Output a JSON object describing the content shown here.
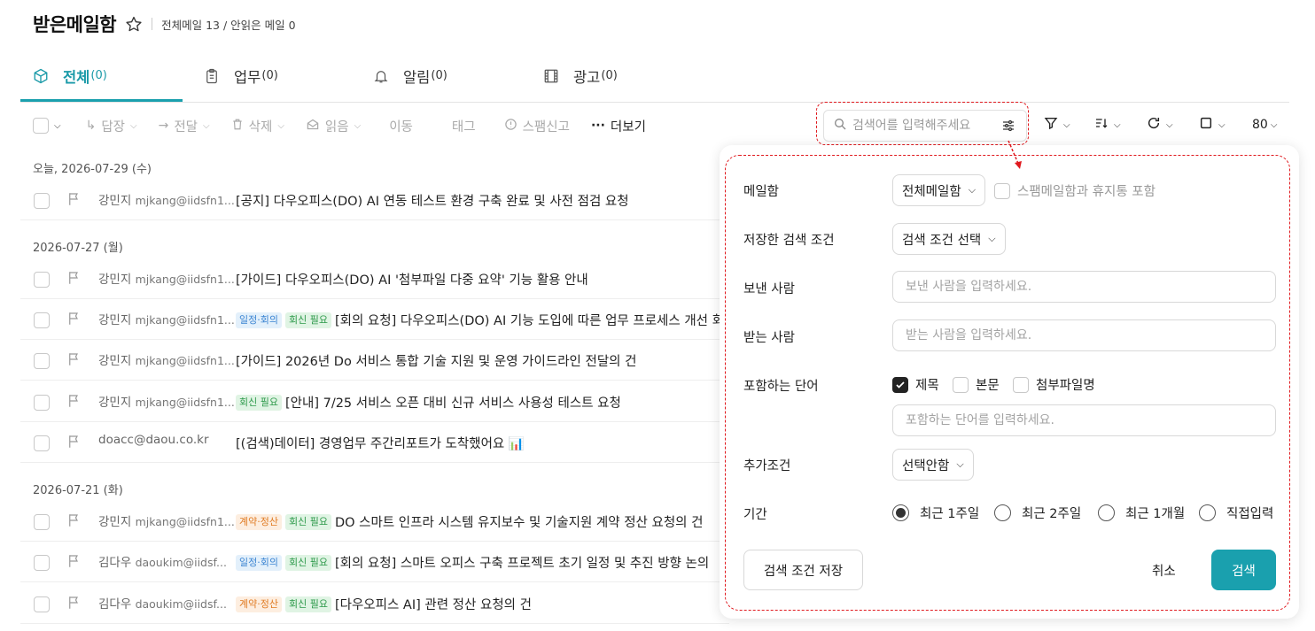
{
  "header": {
    "title": "받은메일함",
    "counts": "전체메일 13 / 안읽은 메일 0"
  },
  "tabs": [
    {
      "label": "전체",
      "count": "(0)",
      "icon": "package-icon"
    },
    {
      "label": "업무",
      "count": "(0)",
      "icon": "clipboard-icon"
    },
    {
      "label": "알림",
      "count": "(0)",
      "icon": "bell-icon"
    },
    {
      "label": "광고",
      "count": "(0)",
      "icon": "film-icon"
    }
  ],
  "toolbar": {
    "reply": "답장",
    "forward": "전달",
    "delete": "삭제",
    "read": "읽음",
    "move": "이동",
    "tag": "태그",
    "spam": "스팸신고",
    "more": "더보기",
    "page_size": "80"
  },
  "search": {
    "placeholder": "검색어를 입력해주세요"
  },
  "groups": [
    {
      "date": "오늘, 2026-07-29 (수)"
    },
    {
      "date": "2026-07-27 (월)"
    },
    {
      "date": "2026-07-21 (화)"
    }
  ],
  "mails": [
    {
      "sender": "강민지",
      "email": "mjkang@iidsfn1...",
      "subject": "[공지] 다우오피스(DO) AI 연동 테스트 환경 구축 완료 및 사전 점검 요청",
      "tags": []
    },
    {
      "sender": "강민지",
      "email": "mjkang@iidsfn1...",
      "subject": "[가이드] 다우오피스(DO) AI '첨부파일 다중 요약' 기능 활용 안내",
      "tags": []
    },
    {
      "sender": "강민지",
      "email": "mjkang@iidsfn1...",
      "subject": "[회의 요청] 다우오피스(DO) AI 기능 도입에 따른 업무 프로세스 개선 회의",
      "tags": [
        "일정·회의",
        "회신 필요"
      ]
    },
    {
      "sender": "강민지",
      "email": "mjkang@iidsfn1...",
      "subject": "[가이드] 2026년 Do 서비스 통합 기술 지원 및 운영 가이드라인 전달의 건",
      "tags": []
    },
    {
      "sender": "강민지",
      "email": "mjkang@iidsfn1...",
      "subject": "[안내] 7/25 서비스 오픈 대비 신규 서비스 사용성 테스트 요청",
      "tags": [
        "회신 필요"
      ]
    },
    {
      "sender": "doacc@daou.co.kr",
      "email": "",
      "subject": "[(검색)데이터] 경영업무 주간리포트가 도착했어요 📊",
      "tags": []
    },
    {
      "sender": "강민지",
      "email": "mjkang@iidsfn1...",
      "subject": "DO 스마트 인프라 시스템 유지보수 및 기술지원 계약 정산 요청의 건",
      "tags": [
        "계약·정산",
        "회신 필요"
      ]
    },
    {
      "sender": "김다우",
      "email": "daoukim@iidsf...",
      "subject": "[회의 요청] 스마트 오피스 구축 프로젝트 초기 일정 및 추진 방향 논의",
      "tags": [
        "일정·회의",
        "회신 필요"
      ]
    },
    {
      "sender": "김다우",
      "email": "daoukim@iidsf...",
      "subject": "[다우오피스 AI] 관련 정산 요청의 건",
      "tags": [
        "계약·정산",
        "회신 필요"
      ]
    }
  ],
  "panel": {
    "mailbox_label": "메일함",
    "mailbox_value": "전체메일함",
    "include_spam": "스팸메일함과 휴지통 포함",
    "saved_label": "저장한 검색 조건",
    "saved_value": "검색 조건 선택",
    "from_label": "보낸 사람",
    "from_placeholder": "보낸 사람을 입력하세요.",
    "to_label": "받는 사람",
    "to_placeholder": "받는 사람을 입력하세요.",
    "words_label": "포함하는 단어",
    "opt_subject": "제목",
    "opt_body": "본문",
    "opt_attach": "첨부파일명",
    "words_placeholder": "포함하는 단어를 입력하세요.",
    "extra_label": "추가조건",
    "extra_value": "선택안함",
    "period_label": "기간",
    "period_1w": "최근 1주일",
    "period_2w": "최근 2주일",
    "period_1m": "최근 1개월",
    "period_custom": "직접입력",
    "save_btn": "검색 조건 저장",
    "cancel_btn": "취소",
    "search_btn": "검색"
  },
  "colors": {
    "accent": "#1aa0ae",
    "highlight": "#e0191e"
  }
}
